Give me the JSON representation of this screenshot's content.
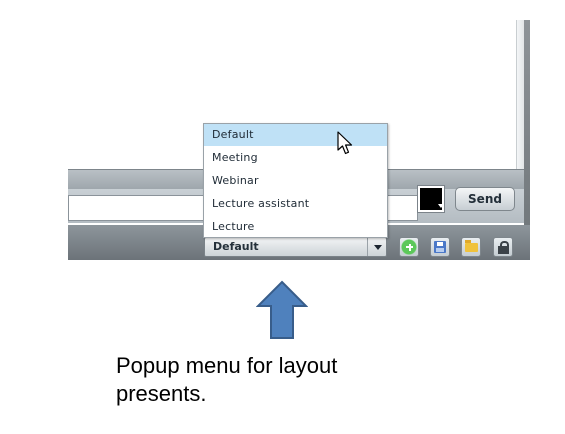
{
  "composer": {
    "message_value": "",
    "send_label": "Send",
    "text_color": "#000000"
  },
  "layout_selector": {
    "selected": "Default"
  },
  "popup_menu": {
    "items": [
      "Default",
      "Meeting",
      "Webinar",
      "Lecture assistant",
      "Lecture"
    ],
    "highlighted_index": 0,
    "highlight_color": "#bfe1f6"
  },
  "toolbar_icons": [
    "add-icon",
    "save-icon",
    "folder-icon",
    "lock-icon"
  ],
  "annotation": {
    "arrow_color": "#4f81bd",
    "caption_line1": "Popup menu for layout",
    "caption_line2": "presents."
  }
}
